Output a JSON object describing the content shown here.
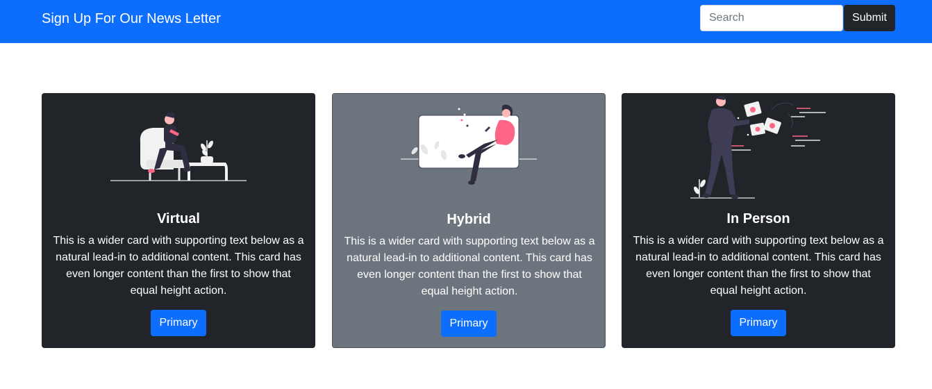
{
  "navbar": {
    "brand": "Sign Up For Our News Letter",
    "search_placeholder": "Search",
    "search_value": "",
    "submit_label": "Submit"
  },
  "cards": [
    {
      "title": "Virtual",
      "text": "This is a wider card with supporting text below as a natural lead-in to additional content. This card has even longer content than the first to show that equal height action.",
      "button_label": "Primary",
      "illustration": "person-in-chair-illustration"
    },
    {
      "title": "Hybrid",
      "text": "This is a wider card with supporting text below as a natural lead-in to additional content. This card has even longer content than the first to show that equal height action.",
      "button_label": "Primary",
      "illustration": "person-sitting-on-screen-illustration"
    },
    {
      "title": "In Person",
      "text": "This is a wider card with supporting text below as a natural lead-in to additional content. This card has even longer content than the first to show that equal height action.",
      "button_label": "Primary",
      "illustration": "person-with-image-cards-illustration"
    }
  ],
  "colors": {
    "primary": "#0d6efd",
    "dark": "#212529",
    "secondary": "#6c757d",
    "accent_pink": "#ff6584"
  }
}
